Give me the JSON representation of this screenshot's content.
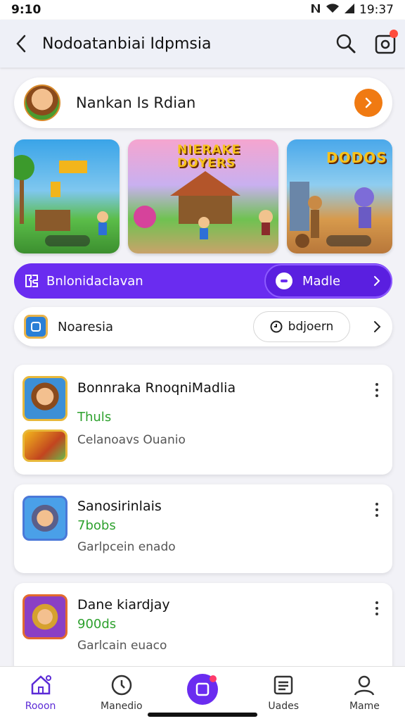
{
  "status_bar": {
    "time": "9:10",
    "right_text": "19:37"
  },
  "app_bar": {
    "title": "Nodoatanbiai Idpmsia"
  },
  "profile": {
    "name": "Nankan Is Rdian"
  },
  "banners": [
    {
      "label": "",
      "colors": [
        "#2e9be0",
        "#55b84a"
      ]
    },
    {
      "label": "NIERAKE DOYERS",
      "colors": [
        "#f29cc8",
        "#5fbb4a"
      ]
    },
    {
      "label": "DODOS",
      "colors": [
        "#4da8e8",
        "#d98b3c"
      ]
    }
  ],
  "primary_bar": {
    "label": "Bnlonidaclavan",
    "pill_label": "Madle"
  },
  "secondary_bar": {
    "name": "Noaresia",
    "pill_label": "bdjoern"
  },
  "games": [
    {
      "title": "Bonnraka RnoqniMadlia",
      "tag": "Thuls",
      "subtitle": "Celanoavs Ouanio"
    },
    {
      "title": "Sanosirinlais",
      "tag": "7bobs",
      "subtitle": "Garlpcein enado"
    },
    {
      "title": "Dane kiardjay",
      "tag": "900ds",
      "subtitle": "Garlcain euaco"
    }
  ],
  "nav": [
    {
      "label": "Rooon",
      "icon": "home-icon"
    },
    {
      "label": "Manedio",
      "icon": "clock-icon"
    },
    {
      "label": "",
      "icon": "edit-icon"
    },
    {
      "label": "Uades",
      "icon": "list-icon"
    },
    {
      "label": "Mame",
      "icon": "person-icon"
    }
  ],
  "colors": {
    "accent": "#6a2cf0",
    "orange": "#f07a12",
    "green": "#2ea12e"
  }
}
